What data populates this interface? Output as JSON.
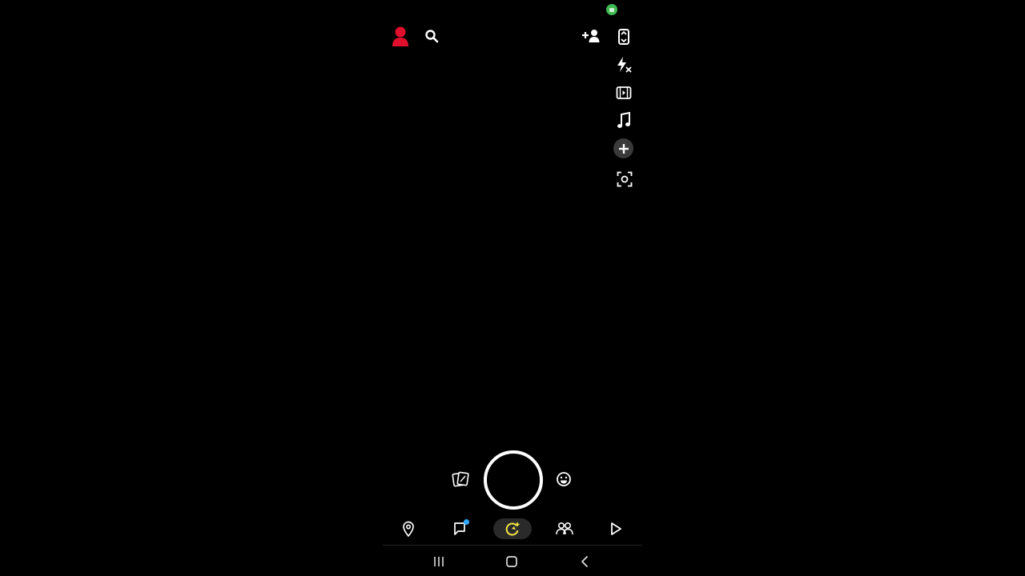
{
  "app": "camera",
  "colors": {
    "background": "#000000",
    "profile_avatar": "#e0102c",
    "camera_in_use_indicator": "#3fb950",
    "active_nav": "#f5e642",
    "notification_dot": "#2fa8ff"
  },
  "top_bar": {
    "left": [
      "profile-avatar-icon",
      "search-icon"
    ],
    "right": [
      "add-friend-icon"
    ]
  },
  "side_toolbar": [
    "flip-camera-icon",
    "flash-off-icon",
    "video-timeline-icon",
    "music-note-icon",
    "plus-icon",
    "scan-icon"
  ],
  "capture_row": [
    "memories-icon",
    "shutter-button",
    "lenses-emoji-icon"
  ],
  "bottom_nav": {
    "items": [
      "map-pin-icon",
      "chat-icon",
      "camera-sparkle-icon",
      "friends-icon",
      "play-icon"
    ],
    "active": "camera-sparkle-icon",
    "chat_has_notification": true
  },
  "system_nav": [
    "recent-apps-icon",
    "home-icon",
    "back-icon"
  ]
}
